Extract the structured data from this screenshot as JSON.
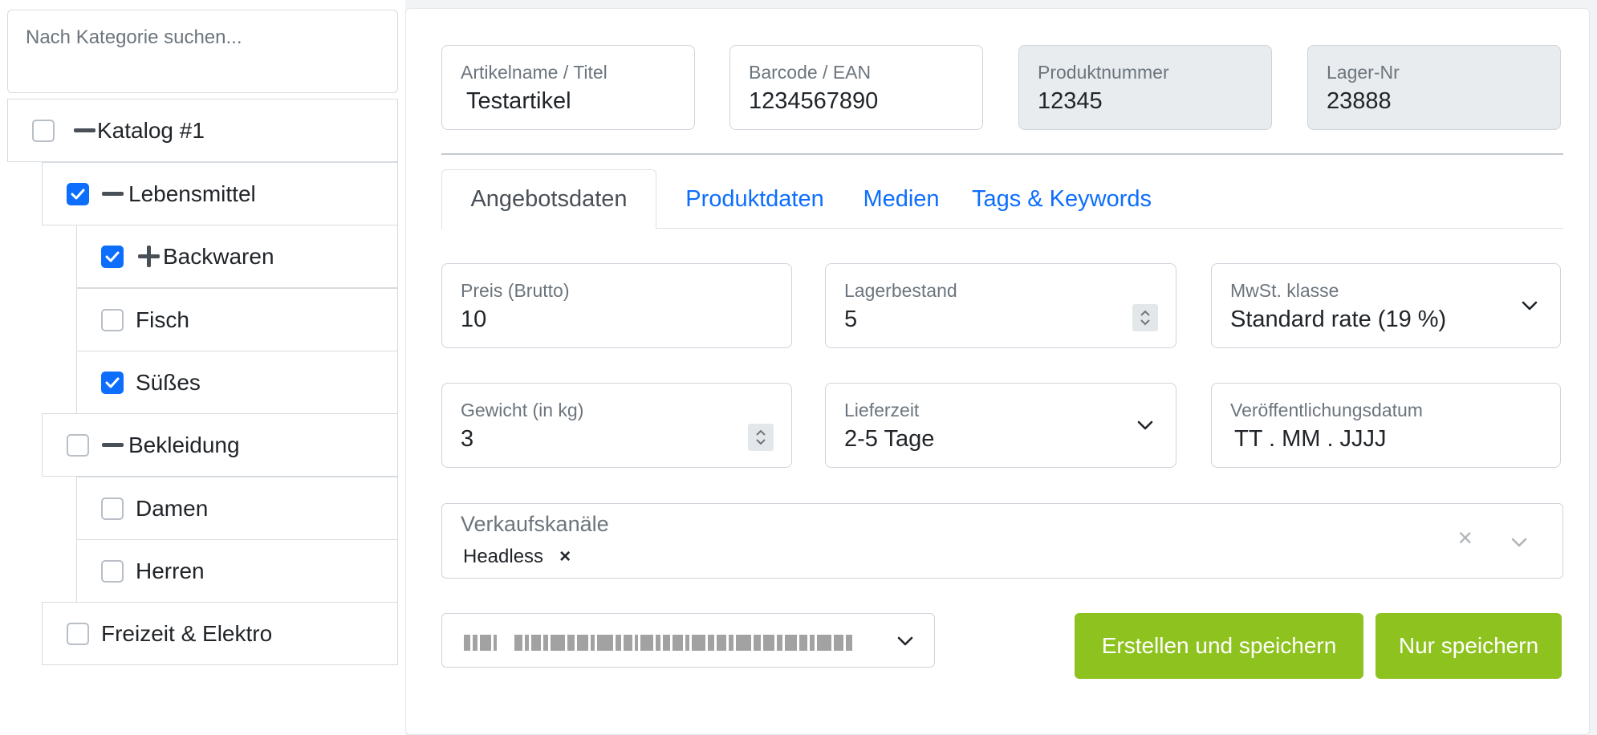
{
  "category_tree": {
    "search_placeholder": "Nach Kategorie suchen...",
    "items": [
      {
        "label": "Katalog #1",
        "checked": false,
        "toggle": "collapse"
      },
      {
        "label": "Lebensmittel",
        "checked": true,
        "toggle": "collapse"
      },
      {
        "label": "Backwaren",
        "checked": true,
        "toggle": "expand"
      },
      {
        "label": "Fisch",
        "checked": false,
        "toggle": "none"
      },
      {
        "label": "Süßes",
        "checked": true,
        "toggle": "none"
      },
      {
        "label": "Bekleidung",
        "checked": false,
        "toggle": "collapse"
      },
      {
        "label": "Damen",
        "checked": false,
        "toggle": "none"
      },
      {
        "label": "Herren",
        "checked": false,
        "toggle": "none"
      },
      {
        "label": "Freizeit & Elektro",
        "checked": false,
        "toggle": "none"
      }
    ]
  },
  "header_fields": {
    "title": {
      "label": "Artikelname / Titel",
      "value": "Testartikel"
    },
    "barcode": {
      "label": "Barcode / EAN",
      "value": "1234567890"
    },
    "product_number": {
      "label": "Produktnummer",
      "value": "12345",
      "readonly": true
    },
    "stock_number": {
      "label": "Lager-Nr",
      "value": "23888",
      "readonly": true
    }
  },
  "tabs": [
    {
      "label": "Angebotsdaten",
      "active": true
    },
    {
      "label": "Produktdaten",
      "active": false
    },
    {
      "label": "Medien",
      "active": false
    },
    {
      "label": "Tags & Keywords",
      "active": false
    }
  ],
  "offer": {
    "price": {
      "label": "Preis (Brutto)",
      "value": "10"
    },
    "stock": {
      "label": "Lagerbestand",
      "value": "5"
    },
    "vat": {
      "label": "MwSt. klasse",
      "value": "Standard rate (19 %)"
    },
    "weight": {
      "label": "Gewicht (in kg)",
      "value": "3"
    },
    "delivery": {
      "label": "Lieferzeit",
      "value": "2-5 Tage"
    },
    "publish_date": {
      "label": "Veröffentlichungsdatum",
      "value": "TT . MM . JJJJ"
    }
  },
  "sales_channels": {
    "label": "Verkaufskanäle",
    "chips": [
      {
        "label": "Headless",
        "remove": "×"
      }
    ],
    "clear": "×"
  },
  "buttons": {
    "create_save": "Erstellen und speichern",
    "save_only": "Nur speichern"
  },
  "colors": {
    "primary": "#0d6efd",
    "success": "#8ec21f",
    "readonly_bg": "#e9ecef",
    "border": "#ced4da"
  }
}
